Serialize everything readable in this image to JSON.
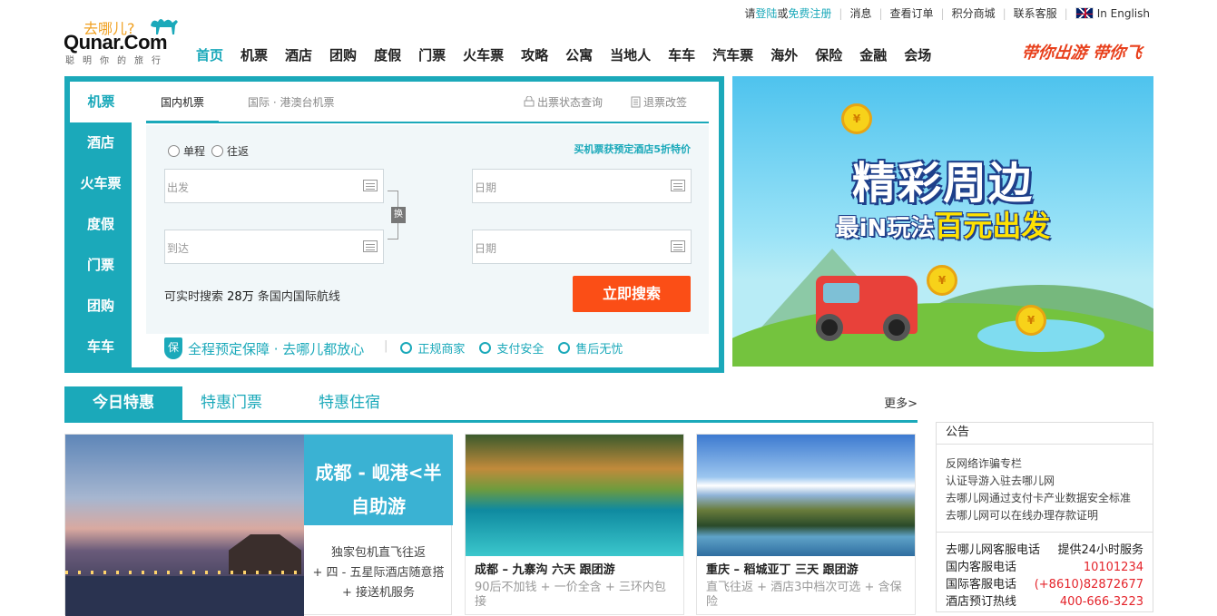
{
  "topbar": {
    "login": "登陆",
    "or": "或",
    "register": "免费注册",
    "messages": "消息",
    "orders": "查看订单",
    "points": "积分商城",
    "support": "联系客服",
    "english": "In English"
  },
  "logo": {
    "cn": "去哪儿?",
    "en": "Qunar.Com",
    "tagline": "聪明你的旅行"
  },
  "nav": [
    "首页",
    "机票",
    "酒店",
    "团购",
    "度假",
    "门票",
    "火车票",
    "攻略",
    "公寓",
    "当地人",
    "车车",
    "汽车票",
    "海外",
    "保险",
    "金融",
    "会场"
  ],
  "slogan": "带你出游 带你飞",
  "search": {
    "sidetabs": [
      "机票",
      "酒店",
      "火车票",
      "度假",
      "门票",
      "团购",
      "车车"
    ],
    "flight_tabs": {
      "domestic": "国内机票",
      "international": "国际 · 港澳台机票"
    },
    "tools": {
      "status": "出票状态查询",
      "refund": "退票改签"
    },
    "trip_types": {
      "oneway": "单程",
      "roundtrip": "往返"
    },
    "promo": "买机票获预定酒店5折特价",
    "fields": {
      "depart_placeholder": "出发",
      "arrive_placeholder": "到达",
      "date1_placeholder": "日期",
      "date2_placeholder": "日期"
    },
    "swap": "换",
    "count_prefix": "可实时搜索",
    "count_value": "28万",
    "count_suffix": "条国内国际航线",
    "button": "立即搜索",
    "guarantee": "全程预定保障 · 去哪儿都放心",
    "badges": [
      "正规商家",
      "支付安全",
      "售后无忧"
    ]
  },
  "banner": {
    "title": "精彩周边",
    "sub_prefix": "最iN玩法",
    "sub_highlight": "百元出发",
    "coin": "¥"
  },
  "deals": {
    "tabs": [
      "今日特惠",
      "特惠门票",
      "特惠住宿"
    ],
    "more": "更多>",
    "featured": {
      "title_line1": "成都 - 岘港<半",
      "title_line2": "自助游",
      "desc": [
        "独家包机直飞往返",
        "+ 四 - 五星际酒店随意搭",
        "+ 接送机服务"
      ]
    },
    "cards": [
      {
        "title": "成都 – 九寨沟  六天    跟团游",
        "desc": "90后不加钱 + 一价全含 + 三环内包接"
      },
      {
        "title": "重庆 – 稻城亚丁  三天    跟团游",
        "desc": "直飞往返 + 酒店3中档次可选 + 含保险"
      }
    ]
  },
  "notice": {
    "title": "公告",
    "items": [
      "反网络诈骗专栏",
      "认证导游入驻去哪儿网",
      "去哪儿网通过支付卡产业数据安全标准",
      "去哪儿网可以在线办理存款证明"
    ],
    "hotlines": [
      {
        "label": "去哪儿网客服电话",
        "value": "提供24小时服务"
      },
      {
        "label": "国内客服电话",
        "value": "10101234"
      },
      {
        "label": "国际客服电话",
        "value": "(+8610)82872677"
      },
      {
        "label": "酒店预订热线",
        "value": "400-666-3223"
      }
    ]
  },
  "colors": {
    "accent": "#1ba9ba",
    "search_button": "#fb4e16",
    "hotline": "#e4242b"
  }
}
